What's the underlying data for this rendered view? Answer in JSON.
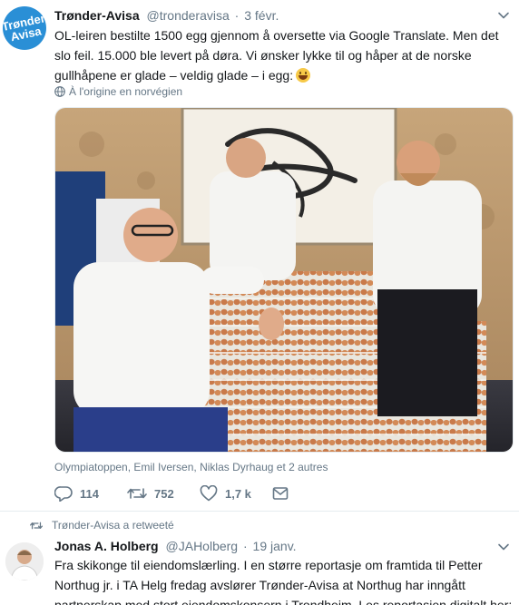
{
  "tweet1": {
    "avatar_lines": [
      "Trønder",
      "Avisa"
    ],
    "name": "Trønder-Avisa",
    "handle": "@tronderavisa",
    "separator": "·",
    "date": "3 févr.",
    "text": "OL-leiren bestilte 1500 egg gjennom å oversette via Google Translate. Men det slo feil. 15.000 ble levert på døra. Vi ønsker lykke til og håper at de norske gullhåpene er glade – veldig glade – i egg:",
    "emoji": "grinning-face-emoji",
    "translation_note": "À l'origine en norvégien",
    "tagged": "Olympiatoppen, Emil Iversen, Niklas Dyrhaug et 2 autres",
    "actions": {
      "reply_count": "114",
      "retweet_count": "752",
      "like_count": "1,7 k"
    }
  },
  "retweet_context": {
    "label": "Trønder-Avisa a retweeté"
  },
  "tweet2": {
    "name": "Jonas A. Holberg",
    "handle": "@JAHolberg",
    "separator": "·",
    "date": "19 janv.",
    "text": "Fra skikonge til eiendomslærling. I en større reportasje om framtida til Petter Northug jr. i TA Helg fredag avslører Trønder-Avisa at Northug har inngått partnerskap med stort eiendomskonsern i Trondheim. Les reportasjen digitalt her:"
  },
  "colors": {
    "text": "#14171a",
    "muted": "#657786",
    "border": "#e6ecf0",
    "avatar_blue": "#2a8fd6"
  }
}
